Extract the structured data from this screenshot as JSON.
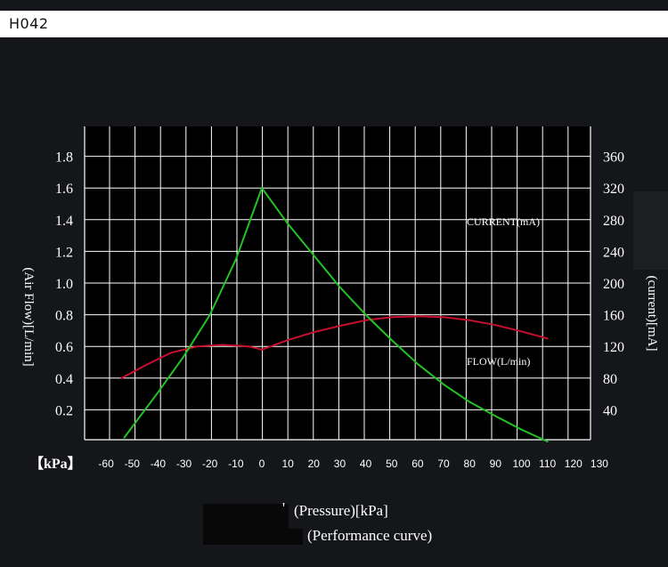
{
  "header": {
    "model": "H042"
  },
  "chart_data": {
    "type": "line",
    "xlabel": "(Pressure)[kPa]",
    "subtitle": "(Performance curve)",
    "x_unit_label": "【kPa】",
    "ylabel_left": "(Air Flow)[L/min]",
    "ylabel_right": "(current)[mA]",
    "x_ticks": [
      -60,
      -50,
      -40,
      -30,
      -20,
      -10,
      0,
      10,
      20,
      30,
      40,
      50,
      60,
      70,
      80,
      90,
      100,
      110,
      120,
      130
    ],
    "y_left_ticks": [
      0.2,
      0.4,
      0.6,
      0.8,
      1.0,
      1.2,
      1.4,
      1.6,
      1.8
    ],
    "y_right_ticks": [
      40,
      80,
      120,
      160,
      200,
      240,
      280,
      320,
      360
    ],
    "xlim": [
      -65,
      135
    ],
    "ylim_left": [
      0,
      2.0
    ],
    "ylim_right": [
      0,
      400
    ],
    "grid": true,
    "series": [
      {
        "name": "FLOW(L/min)",
        "axis": "left",
        "color": "#c8102e",
        "x": [
          -54,
          -45,
          -35,
          -25,
          -15,
          -5,
          0,
          10,
          20,
          30,
          40,
          50,
          60,
          70,
          80,
          90,
          100,
          110
        ],
        "y": [
          0.4,
          0.48,
          0.56,
          0.6,
          0.61,
          0.6,
          0.58,
          0.64,
          0.69,
          0.73,
          0.765,
          0.785,
          0.79,
          0.785,
          0.765,
          0.735,
          0.695,
          0.65
        ]
      },
      {
        "name": "CURRENT(mA)",
        "axis": "right",
        "color": "#22c322",
        "x": [
          -53,
          -40,
          -30,
          -20,
          -10,
          0,
          10,
          20,
          30,
          40,
          50,
          60,
          70,
          80,
          90,
          100,
          110
        ],
        "y": [
          5,
          62,
          108,
          160,
          230,
          320,
          275,
          235,
          195,
          160,
          128,
          98,
          72,
          50,
          32,
          15,
          0
        ]
      }
    ],
    "footer_prefix": "'"
  }
}
